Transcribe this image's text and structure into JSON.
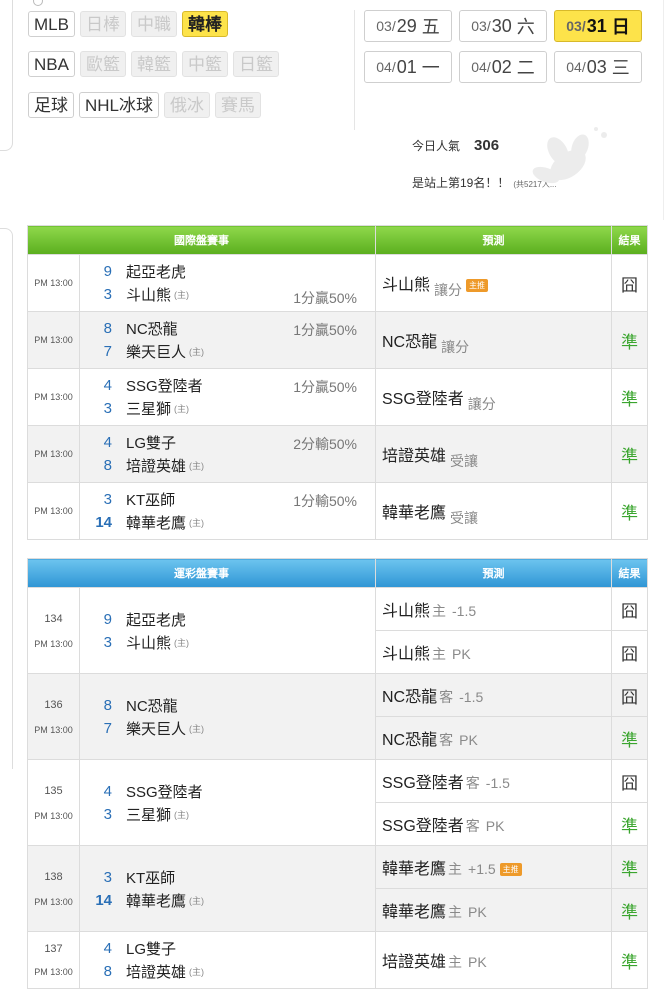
{
  "sports": {
    "row1": [
      {
        "label": "MLB",
        "state": "normal"
      },
      {
        "label": "日棒",
        "state": "disabled"
      },
      {
        "label": "中職",
        "state": "disabled"
      },
      {
        "label": "韓棒",
        "state": "selected"
      }
    ],
    "row2": [
      {
        "label": "NBA",
        "state": "normal"
      },
      {
        "label": "歐籃",
        "state": "disabled"
      },
      {
        "label": "韓籃",
        "state": "disabled"
      },
      {
        "label": "中籃",
        "state": "disabled"
      },
      {
        "label": "日籃",
        "state": "disabled"
      }
    ],
    "row3": [
      {
        "label": "足球",
        "state": "normal"
      },
      {
        "label": "NHL冰球",
        "state": "normal"
      },
      {
        "label": "俄冰",
        "state": "disabled"
      },
      {
        "label": "賽馬",
        "state": "disabled"
      }
    ]
  },
  "dates": [
    {
      "md": "03/",
      "d": "29",
      "w": "五",
      "selected": false
    },
    {
      "md": "03/",
      "d": "30",
      "w": "六",
      "selected": false
    },
    {
      "md": "03/",
      "d": "31",
      "w": "日",
      "selected": true
    },
    {
      "md": "04/",
      "d": "01",
      "w": "一",
      "selected": false
    },
    {
      "md": "04/",
      "d": "02",
      "w": "二",
      "selected": false
    },
    {
      "md": "04/",
      "d": "03",
      "w": "三",
      "selected": false
    }
  ],
  "stats": {
    "pop_label": "今日人氣",
    "pop_value": "306",
    "rank_text": "是站上第19名！！",
    "rank_sub": "(共5217人..."
  },
  "intl": {
    "headers": {
      "event": "國際盤賽事",
      "pred": "預測",
      "result": "結果"
    },
    "rows": [
      {
        "time": "PM 13:00",
        "t1n": "9",
        "t1": "起亞老虎",
        "t2n": "3",
        "t2": "斗山熊",
        "home": "(主)",
        "odds": "1分贏50%",
        "odds_pos": "bottom",
        "pred": "斗山熊",
        "pred_sub": "讓分",
        "tag": "主推",
        "result": "囧",
        "hit": false
      },
      {
        "time": "PM 13:00",
        "t1n": "8",
        "t1": "NC恐龍",
        "t2n": "7",
        "t2": "樂天巨人",
        "home": "(主)",
        "odds": "1分贏50%",
        "odds_pos": "top",
        "pred": "NC恐龍",
        "pred_sub": "讓分",
        "tag": "",
        "result": "準",
        "hit": true
      },
      {
        "time": "PM 13:00",
        "t1n": "4",
        "t1": "SSG登陸者",
        "t2n": "3",
        "t2": "三星獅",
        "home": "(主)",
        "odds": "1分贏50%",
        "odds_pos": "top",
        "pred": "SSG登陸者",
        "pred_sub": "讓分",
        "tag": "",
        "result": "準",
        "hit": true
      },
      {
        "time": "PM 13:00",
        "t1n": "4",
        "t1": "LG雙子",
        "t2n": "8",
        "t2": "培證英雄",
        "home": "(主)",
        "odds": "2分輸50%",
        "odds_pos": "top",
        "pred": "培證英雄",
        "pred_sub": "受讓",
        "tag": "",
        "result": "準",
        "hit": true
      },
      {
        "time": "PM 13:00",
        "t1n": "3",
        "t1": "KT巫師",
        "t2n": "14",
        "t2": "韓華老鷹",
        "home": "(主)",
        "odds": "1分輸50%",
        "odds_pos": "top",
        "pred": "韓華老鷹",
        "pred_sub": "受讓",
        "tag": "",
        "result": "準",
        "hit": true
      }
    ]
  },
  "lottery": {
    "headers": {
      "event": "運彩盤賽事",
      "pred": "預測",
      "result": "結果"
    },
    "games": [
      {
        "id": "134",
        "time": "PM 13:00",
        "t1n": "9",
        "t1": "起亞老虎",
        "t2n": "3",
        "t2": "斗山熊",
        "home": "(主)",
        "preds": [
          {
            "team": "斗山熊",
            "side": "主",
            "line": "-1.5",
            "tag": "",
            "result": "囧",
            "hit": false
          },
          {
            "team": "斗山熊",
            "side": "主",
            "line": "PK",
            "tag": "",
            "result": "囧",
            "hit": false
          }
        ]
      },
      {
        "id": "136",
        "time": "PM 13:00",
        "t1n": "8",
        "t1": "NC恐龍",
        "t2n": "7",
        "t2": "樂天巨人",
        "home": "(主)",
        "preds": [
          {
            "team": "NC恐龍",
            "side": "客",
            "line": "-1.5",
            "tag": "",
            "result": "囧",
            "hit": false
          },
          {
            "team": "NC恐龍",
            "side": "客",
            "line": "PK",
            "tag": "",
            "result": "準",
            "hit": true
          }
        ]
      },
      {
        "id": "135",
        "time": "PM 13:00",
        "t1n": "4",
        "t1": "SSG登陸者",
        "t2n": "3",
        "t2": "三星獅",
        "home": "(主)",
        "preds": [
          {
            "team": "SSG登陸者",
            "side": "客",
            "line": "-1.5",
            "tag": "",
            "result": "囧",
            "hit": false
          },
          {
            "team": "SSG登陸者",
            "side": "客",
            "line": "PK",
            "tag": "",
            "result": "準",
            "hit": true
          }
        ]
      },
      {
        "id": "138",
        "time": "PM 13:00",
        "t1n": "3",
        "t1": "KT巫師",
        "t2n": "14",
        "t2": "韓華老鷹",
        "home": "(主)",
        "preds": [
          {
            "team": "韓華老鷹",
            "side": "主",
            "line": "+1.5",
            "tag": "主推",
            "result": "準",
            "hit": true
          },
          {
            "team": "韓華老鷹",
            "side": "主",
            "line": "PK",
            "tag": "",
            "result": "準",
            "hit": true
          }
        ]
      },
      {
        "id": "137",
        "time": "PM 13:00",
        "t1n": "4",
        "t1": "LG雙子",
        "t2n": "8",
        "t2": "培證英雄",
        "home": "(主)",
        "preds": [
          {
            "team": "培證英雄",
            "side": "主",
            "line": "PK",
            "tag": "",
            "result": "準",
            "hit": true
          }
        ]
      }
    ]
  }
}
